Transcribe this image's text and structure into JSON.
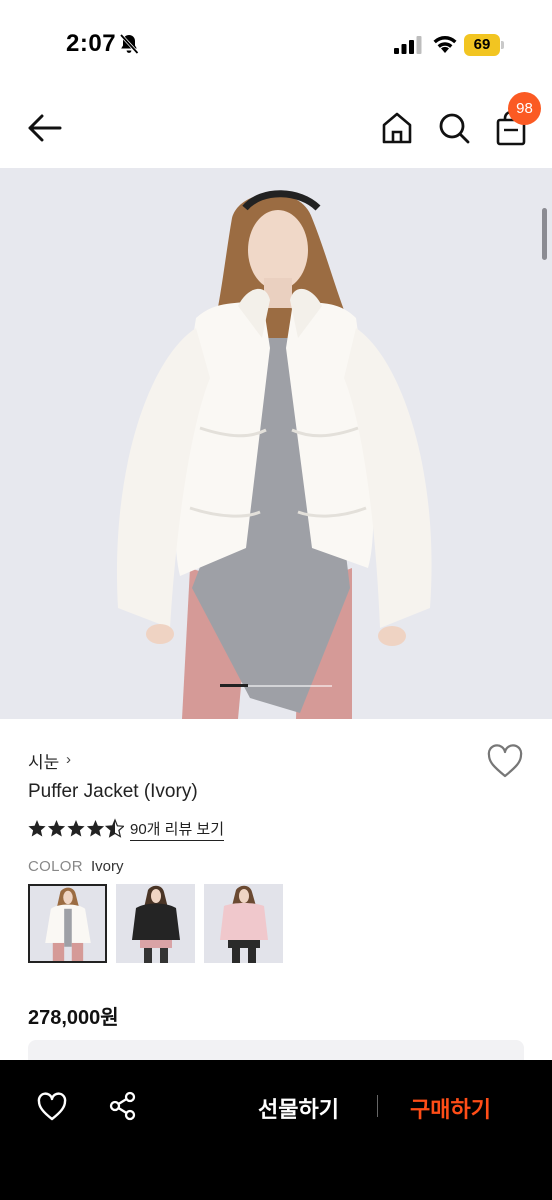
{
  "status_bar": {
    "time": "2:07",
    "battery_level": "69",
    "icons": [
      "bell-slash-icon",
      "cellular-signal-icon",
      "wifi-icon",
      "battery-icon"
    ]
  },
  "header": {
    "icons": [
      "back-arrow-icon",
      "home-icon",
      "search-icon",
      "shopping-bag-icon"
    ],
    "cart_count": "98",
    "badge_color": "#fb5a23"
  },
  "gallery": {
    "current_page": 1,
    "page_count": 4
  },
  "product": {
    "brand": "시눈",
    "brand_chevron": "›",
    "name": "Puffer Jacket (Ivory)",
    "rating": 4.5,
    "rating_max": 5,
    "review_link": "90개 리뷰 보기",
    "color_label": "COLOR",
    "color_value": "Ivory",
    "price": "278,000원",
    "swatches": [
      {
        "name": "Ivory",
        "selected": true
      },
      {
        "name": "Black",
        "selected": false
      },
      {
        "name": "Pink",
        "selected": false
      }
    ]
  },
  "bottom_bar": {
    "gift_label": "선물하기",
    "buy_label": "구매하기",
    "buy_color": "#ff4d17",
    "icons": [
      "heart-outline-icon",
      "share-icon"
    ]
  }
}
